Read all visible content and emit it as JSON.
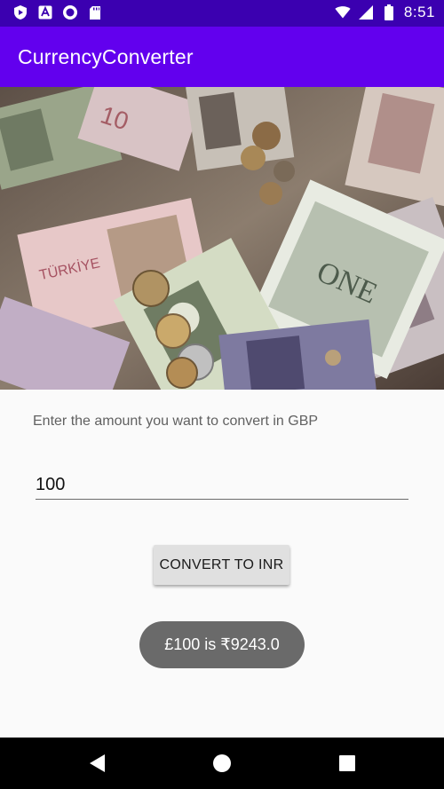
{
  "status_bar": {
    "time": "8:51",
    "icons_left": [
      "play-protect-icon",
      "a-letter-icon",
      "circle-dot-icon",
      "sd-card-icon"
    ],
    "icons_right": [
      "wifi-icon",
      "signal-icon",
      "battery-icon"
    ]
  },
  "app_bar": {
    "title": "CurrencyConverter"
  },
  "banner": {
    "description_icon": "currency-banknotes-image"
  },
  "form": {
    "prompt": "Enter the amount you want to convert in GBP",
    "amount_value": "100",
    "convert_label": "CONVERT TO INR"
  },
  "toast": {
    "message": "£100 is ₹9243.0"
  },
  "nav_bar": {
    "icons": [
      "back-icon",
      "home-icon",
      "recents-icon"
    ]
  },
  "colors": {
    "status_bar": "#3b00b0",
    "app_bar": "#6200ee",
    "toast": "#6a6a6a",
    "button": "#e0e0e0"
  }
}
